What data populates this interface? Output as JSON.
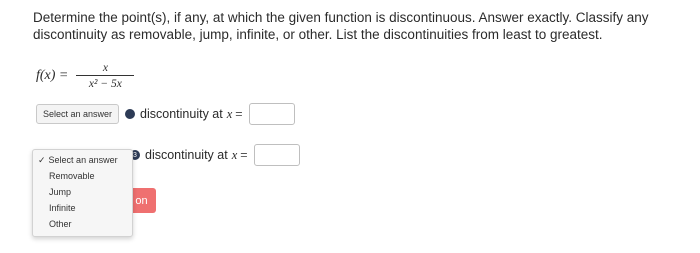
{
  "question": {
    "prompt": "Determine the point(s), if any, at which the given function is discontinuous. Answer exactly. Classify any discontinuity as removable, jump, infinite, or other. List the discontinuities from least to greatest."
  },
  "function": {
    "lhs": "f(x) =",
    "numerator": "x",
    "denominator": "x² − 5x"
  },
  "rows": [
    {
      "select_label": "Select an answer",
      "badge": "",
      "text": "discontinuity at",
      "var": "x",
      "eq": "=",
      "value": ""
    },
    {
      "select_label": "Select an answer",
      "badge": "3",
      "text": "discontinuity at",
      "var": "x",
      "eq": "=",
      "value": ""
    }
  ],
  "dropdown": {
    "check": "✓",
    "options": [
      "Select an answer",
      "Removable",
      "Jump",
      "Infinite",
      "Other"
    ]
  },
  "button": {
    "label": "on",
    "color": "#ef7070"
  }
}
